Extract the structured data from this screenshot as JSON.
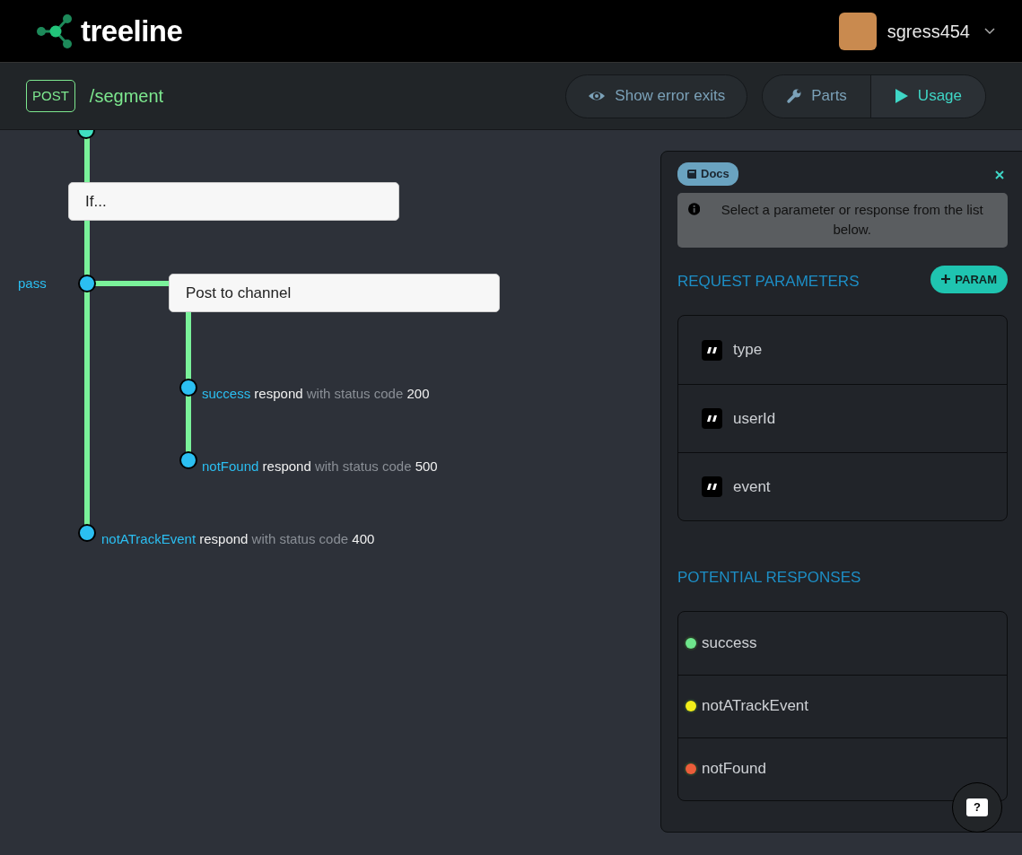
{
  "header": {
    "brand": "treeline",
    "user": {
      "name": "sgress454"
    }
  },
  "toolbar": {
    "method": "POST",
    "path": "/segment",
    "buttons": [
      {
        "label": "Show error exits"
      }
    ],
    "view_tabs": [
      {
        "label": "Parts",
        "selected": false
      },
      {
        "label": "Usage",
        "selected": true
      }
    ]
  },
  "flow": {
    "condition": {
      "label": "If..."
    },
    "branch_label": "pass",
    "action": {
      "label": "Post to channel",
      "exits": [
        {
          "name": "success",
          "action": "respond",
          "detail": "with status code",
          "code": "200"
        },
        {
          "name": "notFound",
          "action": "respond",
          "detail": "with status code",
          "code": "500"
        }
      ]
    },
    "fallback_exits": [
      {
        "name": "notATrackEvent",
        "action": "respond",
        "detail": "with status code",
        "code": "400"
      }
    ]
  },
  "docs": {
    "badge": "Docs",
    "info": "Select a parameter or response from the list below.",
    "request_parameters": {
      "title": "REQUEST PARAMETERS",
      "add_button": "PARAM",
      "items": [
        {
          "name": "type"
        },
        {
          "name": "userId"
        },
        {
          "name": "event"
        }
      ]
    },
    "potential_responses": {
      "title": "POTENTIAL RESPONSES",
      "items": [
        {
          "name": "success",
          "color": "#6ee68c"
        },
        {
          "name": "notATrackEvent",
          "color": "#f2ee1a"
        },
        {
          "name": "notFound",
          "color": "#ea5d3a"
        }
      ]
    }
  },
  "help": {
    "label": "?"
  }
}
